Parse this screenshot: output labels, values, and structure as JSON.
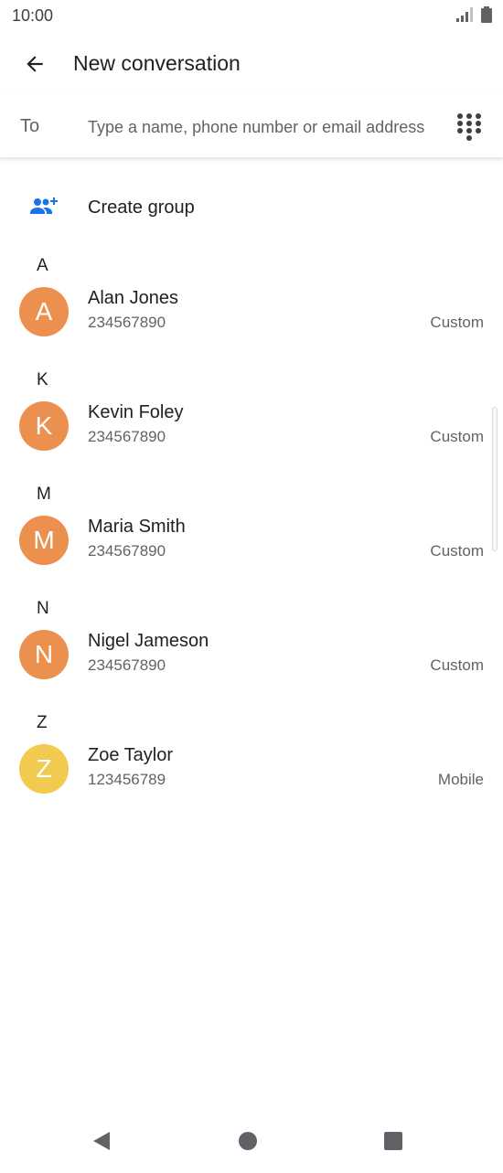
{
  "status_bar": {
    "time": "10:00"
  },
  "app_bar": {
    "title": "New conversation"
  },
  "recipient": {
    "label": "To",
    "value": "",
    "placeholder": "Type a name, phone number or email address"
  },
  "create_group": {
    "label": "Create group"
  },
  "sections": [
    {
      "letter": "A",
      "contacts": [
        {
          "initial": "A",
          "name": "Alan Jones",
          "number": "234567890",
          "type": "Custom",
          "color": "#ec9050"
        }
      ]
    },
    {
      "letter": "K",
      "contacts": [
        {
          "initial": "K",
          "name": "Kevin Foley",
          "number": "234567890",
          "type": "Custom",
          "color": "#ec9050"
        }
      ]
    },
    {
      "letter": "M",
      "contacts": [
        {
          "initial": "M",
          "name": "Maria Smith",
          "number": "234567890",
          "type": "Custom",
          "color": "#ec9050"
        }
      ]
    },
    {
      "letter": "N",
      "contacts": [
        {
          "initial": "N",
          "name": "Nigel Jameson",
          "number": "234567890",
          "type": "Custom",
          "color": "#ec9050"
        }
      ]
    },
    {
      "letter": "Z",
      "contacts": [
        {
          "initial": "Z",
          "name": "Zoe Taylor",
          "number": "123456789",
          "type": "Mobile",
          "color": "#f2ca4f"
        }
      ]
    }
  ],
  "colors": {
    "accent": "#1a73e8",
    "text_primary": "#202124",
    "text_secondary": "#5f6368"
  },
  "icons": {
    "back": "arrow-back-icon",
    "dialpad": "dialpad-icon",
    "group": "group-add-icon",
    "signal": "signal-icon",
    "battery": "battery-icon"
  }
}
